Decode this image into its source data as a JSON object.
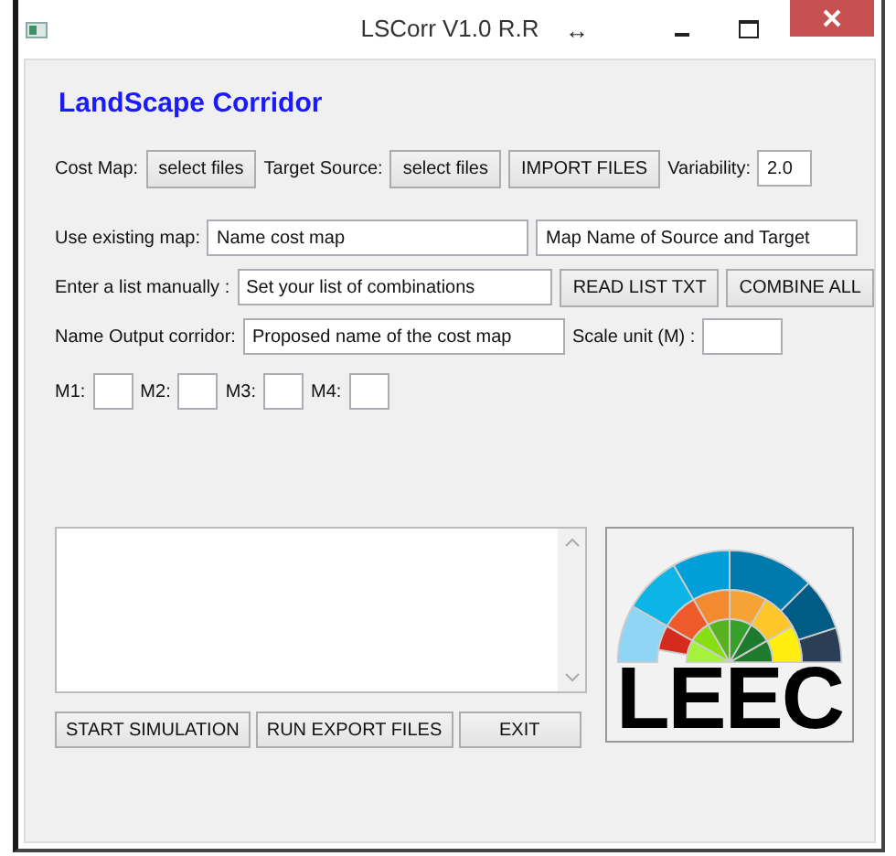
{
  "window": {
    "title": "LSCorr V1.0 R.R",
    "resize_glyph": "↔"
  },
  "heading": "LandScape Corridor",
  "rows": [
    [
      {
        "kind": "label",
        "text": "Cost Map:"
      },
      {
        "kind": "button",
        "text": "select files"
      },
      {
        "kind": "label",
        "text": "Target Source:"
      },
      {
        "kind": "button",
        "text": "select files"
      },
      {
        "kind": "button",
        "text": "IMPORT FILES"
      },
      {
        "kind": "label",
        "text": "Variability:"
      },
      {
        "kind": "small_field",
        "value": "2.0"
      }
    ],
    [
      {
        "kind": "label",
        "text": "Use existing map:"
      },
      {
        "kind": "field",
        "value": "Name cost map"
      },
      {
        "kind": "field",
        "value": "Map Name of Source and Target"
      }
    ],
    [
      {
        "kind": "label",
        "text": "Enter a list manually :"
      },
      {
        "kind": "field",
        "value": "Set your list of combinations"
      },
      {
        "kind": "button",
        "text": "READ LIST TXT"
      },
      {
        "kind": "button",
        "text": "COMBINE ALL"
      }
    ],
    [
      {
        "kind": "label",
        "text": "Name Output corridor:"
      },
      {
        "kind": "field",
        "value": "Proposed name of the cost map"
      },
      {
        "kind": "label",
        "text": "Scale unit (M) :"
      },
      {
        "kind": "small_field"
      }
    ],
    [
      {
        "kind": "label",
        "text": "M1:"
      },
      {
        "kind": "tiny_field"
      },
      {
        "kind": "label",
        "text": "M2:"
      },
      {
        "kind": "tiny_field"
      },
      {
        "kind": "label",
        "text": "M3:"
      },
      {
        "kind": "tiny_field"
      },
      {
        "kind": "label",
        "text": "M4:"
      },
      {
        "kind": "tiny_field"
      }
    ]
  ],
  "actions": [
    "START SIMULATION",
    "RUN  EXPORT FILES",
    "EXIT"
  ],
  "logo": {
    "text": "LEEC"
  }
}
